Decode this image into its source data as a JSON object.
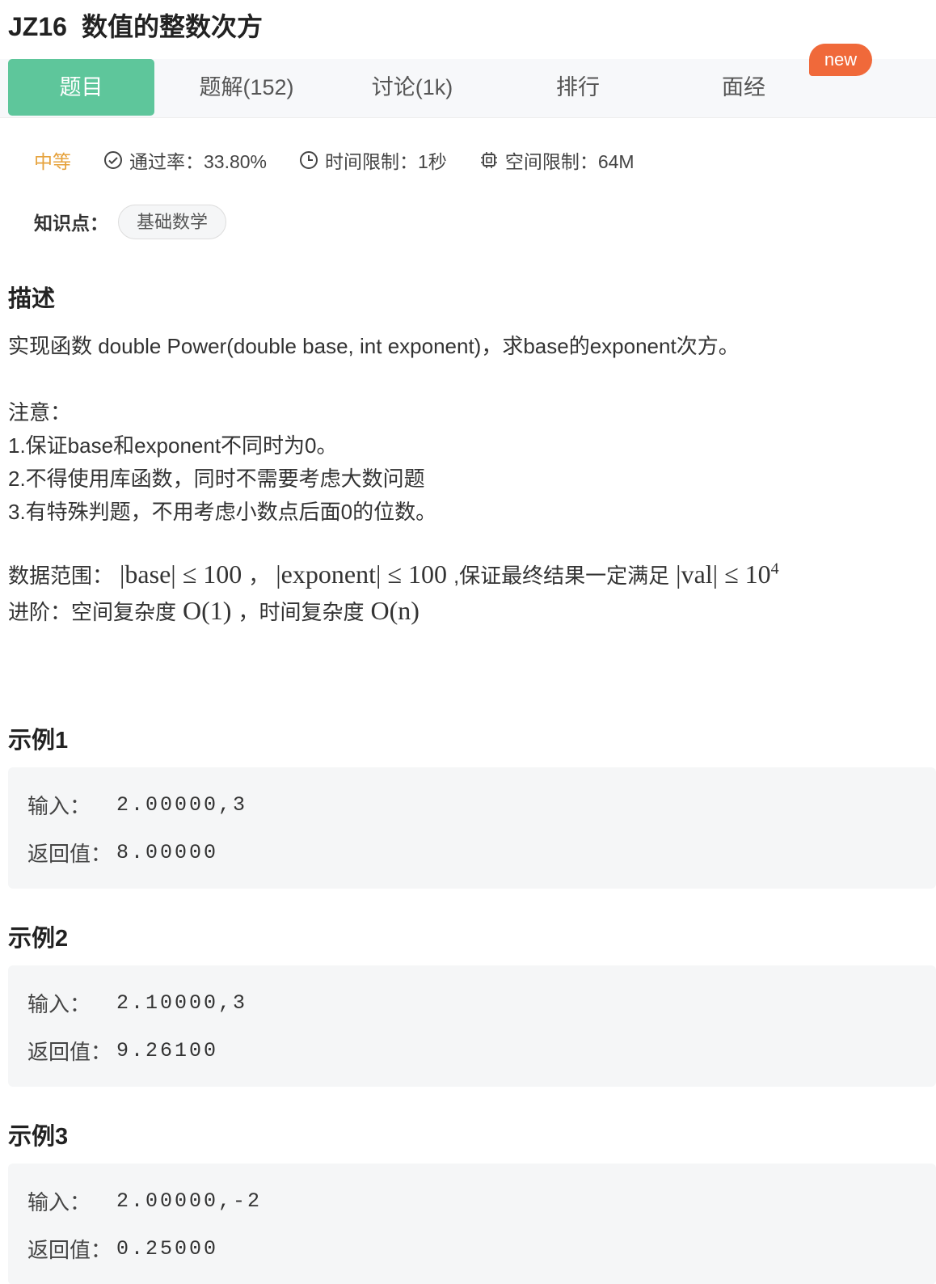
{
  "problem": {
    "code": "JZ16",
    "title": "数值的整数次方"
  },
  "tabs": [
    {
      "label": "题目",
      "active": true
    },
    {
      "label": "题解(152)",
      "active": false
    },
    {
      "label": "讨论(1k)",
      "active": false
    },
    {
      "label": "排行",
      "active": false
    },
    {
      "label": "面经",
      "active": false
    }
  ],
  "new_badge": "new",
  "meta": {
    "difficulty": "中等",
    "pass_rate": "通过率：33.80%",
    "time_limit": "时间限制：1秒",
    "memory_limit": "空间限制：64M"
  },
  "knowledge": {
    "label": "知识点：",
    "tag": "基础数学"
  },
  "description": {
    "heading": "描述",
    "main": "实现函数 double Power(double base, int exponent)，求base的exponent次方。",
    "notice_title": "注意：",
    "notice_items": [
      "1.保证base和exponent不同时为0。",
      "2.不得使用库函数，同时不需要考虑大数问题",
      "3.有特殊判题，不用考虑小数点后面0的位数。"
    ],
    "range_label": "数据范围：",
    "range_math1": "|base| ≤ 100",
    "range_sep": "，",
    "range_math2": "|exponent| ≤ 100",
    "range_mid": ",保证最终结果一定满足",
    "range_math3": "|val| ≤ 10",
    "range_exp": "4",
    "adv_label": "进阶：空间复杂度",
    "adv_math1": "O(1)",
    "adv_sep": "，时间复杂度",
    "adv_math2": "O(n)"
  },
  "examples": [
    {
      "heading": "示例1",
      "input_label": "输入：",
      "input": "2.00000,3",
      "output_label": "返回值：",
      "output": "8.00000"
    },
    {
      "heading": "示例2",
      "input_label": "输入：",
      "input": "2.10000,3",
      "output_label": "返回值：",
      "output": "9.26100"
    },
    {
      "heading": "示例3",
      "input_label": "输入：",
      "input": "2.00000,-2",
      "output_label": "返回值：",
      "output": "0.25000"
    }
  ],
  "colors": {
    "accent": "#5ec69b",
    "difficulty": "#e6a23c",
    "badge": "#f0693a"
  },
  "icons": {
    "pass_rate": "check-circle-icon",
    "time_limit": "clock-icon",
    "memory_limit": "chip-icon"
  }
}
